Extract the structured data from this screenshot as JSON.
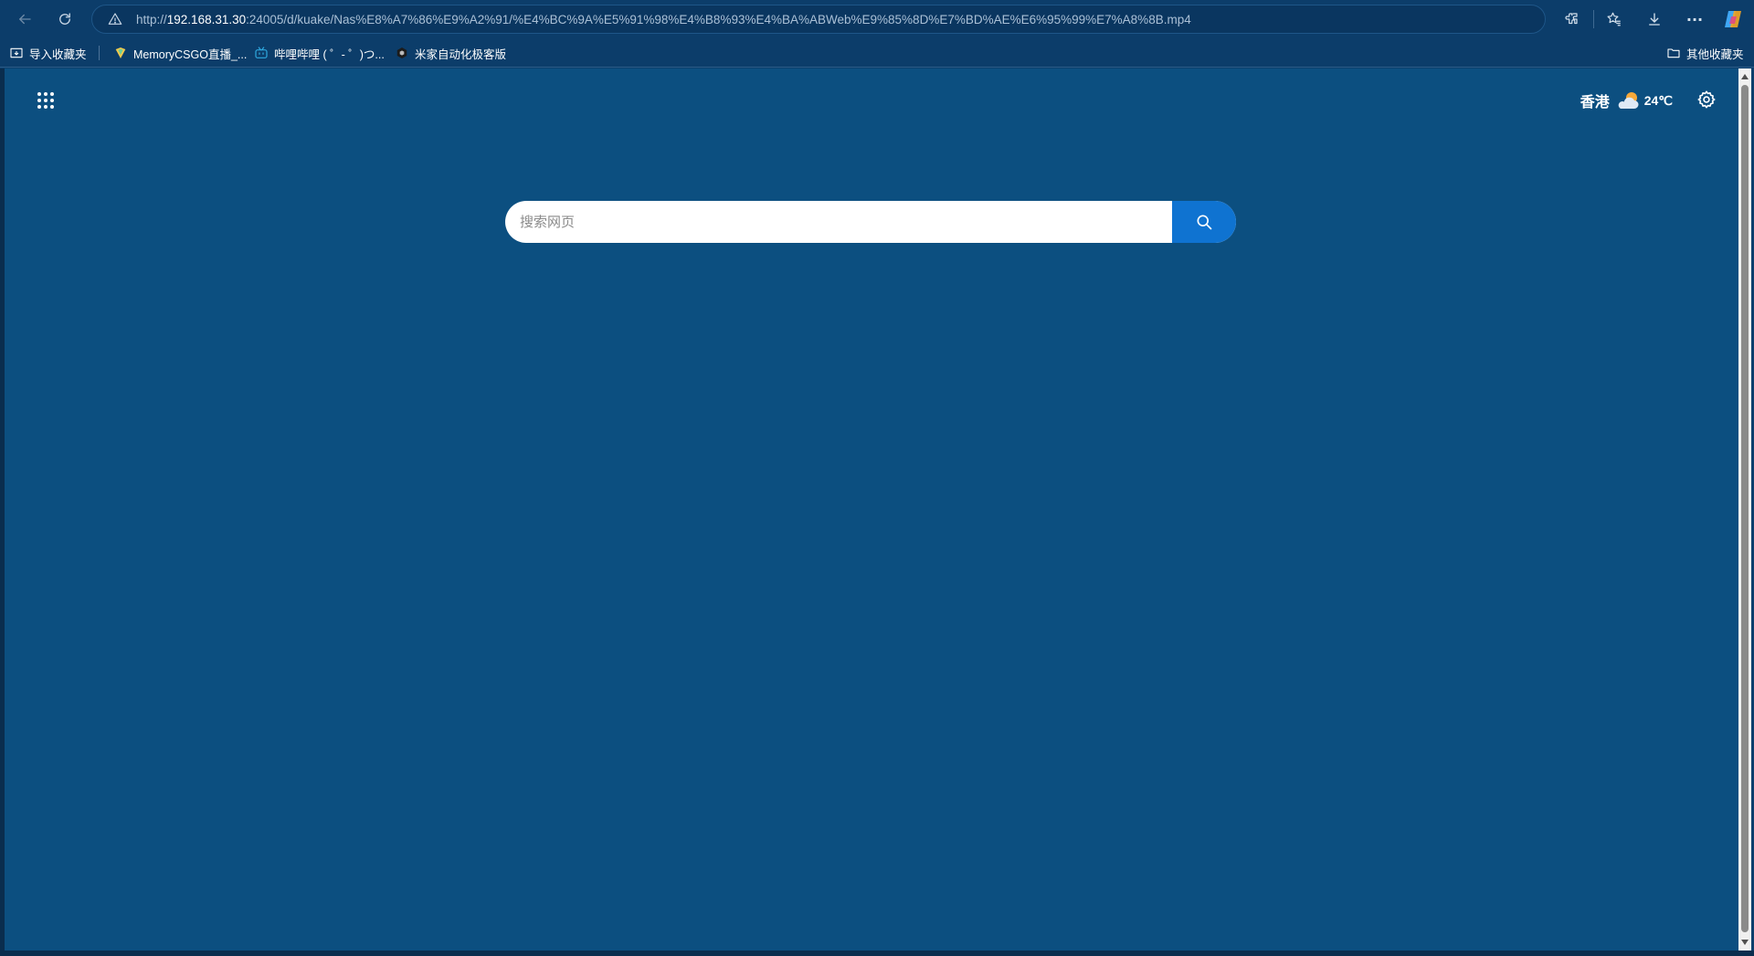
{
  "browser": {
    "address": {
      "url_prefix": "http://",
      "url_host": "192.168.31.30",
      "url_rest": ":24005/d/kuake/Nas%E8%A7%86%E9%A2%91/%E4%BC%9A%E5%91%98%E4%B8%93%E4%BA%ABWeb%E9%85%8D%E7%BD%AE%E6%95%99%E7%A8%8B.mp4"
    },
    "nav": {
      "back_icon": "arrow-left-icon",
      "reload_icon": "reload-icon"
    },
    "toolbar_icons": [
      "extensions-icon",
      "favorites-icon",
      "downloads-icon",
      "more-icon",
      "copilot-icon"
    ],
    "more_label": "···"
  },
  "bookmarks": {
    "items": [
      {
        "label": "导入收藏夹",
        "icon": "import-favorites-icon"
      },
      {
        "label": "MemoryCSGO直播_...",
        "icon": "site-favicon"
      },
      {
        "label": "哔哩哔哩 ( ゜- ゜)つ...",
        "icon": "bilibili-icon"
      },
      {
        "label": "米家自动化极客版",
        "icon": "mijia-icon"
      }
    ],
    "other_folder": {
      "label": "其他收藏夹",
      "icon": "folder-icon"
    }
  },
  "newtab": {
    "weather": {
      "city": "香港",
      "temp": "24℃",
      "icon": "partly-cloudy-icon"
    },
    "search": {
      "placeholder": "搜索网页",
      "value": ""
    }
  },
  "colors": {
    "page_bg": "#0c4f80",
    "chrome_bg": "#0c3d6a",
    "search_button": "#0f73d1"
  }
}
